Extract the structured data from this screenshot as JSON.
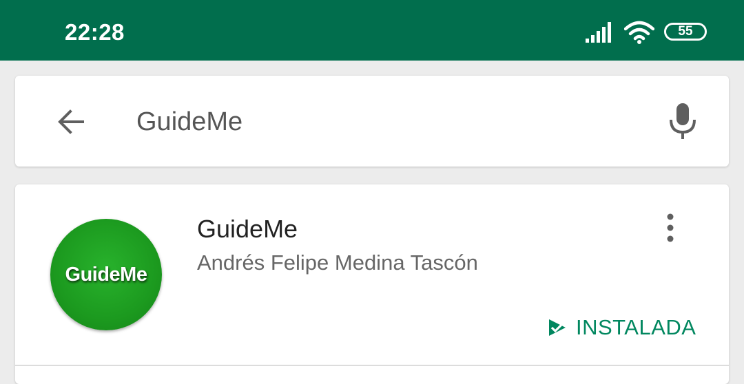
{
  "status_bar": {
    "time": "22:28",
    "battery_level": "55",
    "signal_icon": "signal-icon",
    "wifi_icon": "wifi-icon",
    "background_color": "#016e4d"
  },
  "search": {
    "query": "GuideMe",
    "back_icon": "arrow-back-icon",
    "mic_icon": "mic-icon"
  },
  "result": {
    "app_title": "GuideMe",
    "developer": "Andrés Felipe Medina Tascón",
    "logo_text": "GuideMe",
    "install_status": "INSTALADA",
    "status_color": "#01875f",
    "more_icon": "more-vert-icon"
  }
}
